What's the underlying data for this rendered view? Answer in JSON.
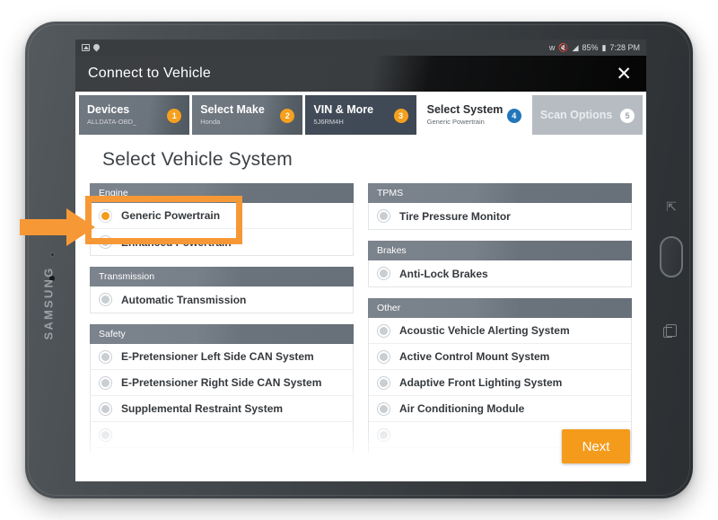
{
  "device": {
    "brand": "SAMSUNG",
    "hw_back_icon": "back-arrow-icon",
    "hw_home_icon": "home-button",
    "hw_recents_icon": "recents-icon"
  },
  "statusbar": {
    "left_icons": [
      "screenshot-image-icon",
      "location-pin-icon"
    ],
    "right_icons": [
      "bluetooth-icon",
      "mute-icon",
      "wifi-icon"
    ],
    "battery_percent": "85%",
    "battery_icon": "battery-icon",
    "time": "7:28 PM"
  },
  "dialog": {
    "title": "Connect to Vehicle",
    "close_label": "✕"
  },
  "tabs": [
    {
      "label": "Devices",
      "sub": "ALLDATA-OBD_",
      "badge": "1",
      "style": "style-grey"
    },
    {
      "label": "Select Make",
      "sub": "Honda",
      "badge": "2",
      "style": "style-grey"
    },
    {
      "label": "VIN & More",
      "sub": "5J6RM4H",
      "badge": "3",
      "style": "style-dark"
    },
    {
      "label": "Select System",
      "sub": "Generic Powertrain",
      "badge": "4",
      "style": "style-active"
    },
    {
      "label": "Scan Options",
      "sub": "",
      "badge": "5",
      "style": "style-disabled"
    }
  ],
  "page": {
    "heading": "Select Vehicle System",
    "next_label": "Next"
  },
  "colors": {
    "accent_orange": "#f49b1c",
    "callout_orange": "#f79837",
    "active_badge_blue": "#2277bb",
    "group_header_grey": "#6f7780"
  },
  "columns": [
    {
      "groups": [
        {
          "title": "Engine",
          "items": [
            {
              "label": "Generic Powertrain",
              "selected": true
            },
            {
              "label": "Enhanced Powertrain",
              "selected": false
            }
          ]
        },
        {
          "title": "Transmission",
          "items": [
            {
              "label": "Automatic Transmission",
              "selected": false
            }
          ]
        },
        {
          "title": "Safety",
          "items": [
            {
              "label": "E-Pretensioner Left Side CAN System",
              "selected": false
            },
            {
              "label": "E-Pretensioner Right Side CAN System",
              "selected": false
            },
            {
              "label": "Supplemental Restraint System",
              "selected": false
            },
            {
              "label": "",
              "selected": false,
              "fade": "faded"
            },
            {
              "label": "",
              "selected": false,
              "fade": "faded2"
            }
          ]
        }
      ]
    },
    {
      "groups": [
        {
          "title": "TPMS",
          "items": [
            {
              "label": "Tire Pressure Monitor",
              "selected": false
            }
          ]
        },
        {
          "title": "Brakes",
          "items": [
            {
              "label": "Anti-Lock Brakes",
              "selected": false
            }
          ]
        },
        {
          "title": "Other",
          "items": [
            {
              "label": "Acoustic Vehicle Alerting System",
              "selected": false
            },
            {
              "label": "Active Control Mount System",
              "selected": false
            },
            {
              "label": "Adaptive Front Lighting System",
              "selected": false
            },
            {
              "label": "Air Conditioning Module",
              "selected": false
            },
            {
              "label": "",
              "selected": false,
              "fade": "faded"
            },
            {
              "label": "",
              "selected": false,
              "fade": "faded2"
            }
          ]
        }
      ]
    }
  ],
  "annotation": {
    "highlight_target": "Generic Powertrain",
    "arrow_icon": "orange-pointer-arrow",
    "box_icon": "orange-highlight-box"
  }
}
